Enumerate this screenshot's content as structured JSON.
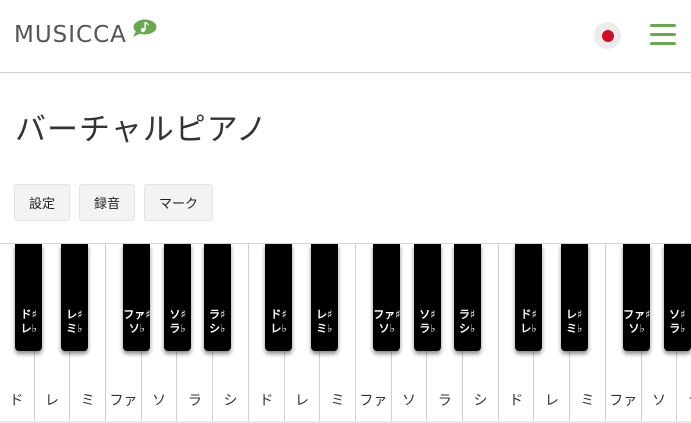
{
  "header": {
    "logo_text": "MUSICCA",
    "language_icon": "japan-flag-icon",
    "menu_icon": "hamburger-menu-icon",
    "accent_color": "#6aa84f"
  },
  "page": {
    "title": "バーチャルピアノ"
  },
  "toolbar": {
    "settings_label": "設定",
    "record_label": "録音",
    "mark_label": "マーク"
  },
  "keyboard": {
    "white_keys": [
      "ド",
      "レ",
      "ミ",
      "ファ",
      "ソ",
      "ラ",
      "シ",
      "ド",
      "レ",
      "ミ",
      "ファ",
      "ソ",
      "ラ",
      "シ",
      "ド",
      "レ",
      "ミ",
      "ファ",
      "ソ",
      "ラ"
    ],
    "black_keys": [
      {
        "top": "ド♯",
        "bottom": "レ♭"
      },
      {
        "top": "レ♯",
        "bottom": "ミ♭"
      },
      {
        "top": "ファ♯",
        "bottom": "ソ♭"
      },
      {
        "top": "ソ♯",
        "bottom": "ラ♭"
      },
      {
        "top": "ラ♯",
        "bottom": "シ♭"
      },
      {
        "top": "ド♯",
        "bottom": "レ♭"
      },
      {
        "top": "レ♯",
        "bottom": "ミ♭"
      },
      {
        "top": "ファ♯",
        "bottom": "ソ♭"
      },
      {
        "top": "ソ♯",
        "bottom": "ラ♭"
      },
      {
        "top": "ラ♯",
        "bottom": "シ♭"
      },
      {
        "top": "ド♯",
        "bottom": "レ♭"
      },
      {
        "top": "レ♯",
        "bottom": "ミ♭"
      },
      {
        "top": "ファ♯",
        "bottom": "ソ♭"
      },
      {
        "top": "ソ♯",
        "bottom": "ラ♭"
      }
    ]
  }
}
